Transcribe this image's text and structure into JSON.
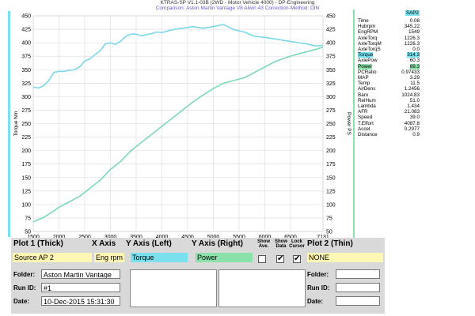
{
  "header": {
    "line1": "KTRAS-SP V1.1-03B  (2WD - Motor Vehicle 4000) - DP-Engineering",
    "line2": "Comparison: Aston Martin Vantage V8 Alwin 43    Correction-Method: DIN"
  },
  "chart_data": {
    "type": "line",
    "xlim": [
      1500,
      7131
    ],
    "x_ticks": [
      "1500",
      "2000",
      "2500",
      "3000",
      "3500",
      "4000",
      "4500",
      "5000",
      "5500",
      "6000",
      "6500",
      "7131"
    ],
    "ylim_left": [
      50,
      450
    ],
    "ylim_right": [
      50,
      450
    ],
    "y_ticks": [
      "50",
      "75",
      "100",
      "125",
      "150",
      "175",
      "200",
      "225",
      "250",
      "275",
      "300",
      "325",
      "350",
      "375",
      "400",
      "425",
      "450"
    ],
    "ylabel_left": "Torque Nm",
    "ylabel_right": "Power PS",
    "grid": true,
    "series": [
      {
        "name": "Torque",
        "axis": "left",
        "color": "#7bd8ea",
        "x": [
          1500,
          1600,
          1700,
          1800,
          1900,
          2000,
          2100,
          2200,
          2300,
          2400,
          2500,
          2600,
          2700,
          2800,
          2900,
          3000,
          3100,
          3200,
          3300,
          3400,
          3500,
          3600,
          3700,
          3800,
          3900,
          4000,
          4200,
          4400,
          4600,
          4800,
          5000,
          5200,
          5400,
          5600,
          5800,
          6000,
          6200,
          6400,
          6600,
          6800,
          7000,
          7131
        ],
        "y": [
          318,
          316,
          320,
          330,
          345,
          347,
          347,
          349,
          350,
          355,
          366,
          370,
          378,
          385,
          398,
          400,
          397,
          403,
          412,
          416,
          416,
          413,
          415,
          417,
          420,
          419,
          424,
          427,
          430,
          427,
          430,
          434,
          424,
          420,
          412,
          410,
          407,
          404,
          401,
          398,
          394,
          395
        ]
      },
      {
        "name": "Power",
        "axis": "right",
        "color": "#7dd8b5",
        "x": [
          1500,
          1600,
          1700,
          1800,
          1900,
          2000,
          2200,
          2400,
          2600,
          2800,
          3000,
          3200,
          3400,
          3600,
          3800,
          4000,
          4200,
          4400,
          4600,
          4800,
          5000,
          5200,
          5400,
          5600,
          5800,
          6000,
          6200,
          6400,
          6600,
          6800,
          7000,
          7131
        ],
        "y": [
          68,
          72,
          76,
          82,
          88,
          95,
          105,
          115,
          130,
          145,
          165,
          180,
          200,
          215,
          230,
          245,
          260,
          275,
          290,
          303,
          315,
          325,
          330,
          335,
          345,
          355,
          365,
          372,
          378,
          383,
          388,
          392
        ]
      }
    ]
  },
  "panel": {
    "title": "SAP2",
    "rows": [
      {
        "label": "Time",
        "value": "0.08"
      },
      {
        "label": "Hubrpm",
        "value": "345.22"
      },
      {
        "label": "EngRPM",
        "value": "1549"
      },
      {
        "label": "AxleTorq",
        "value": "1226.3"
      },
      {
        "label": "AxleTorqM",
        "value": "1226.3"
      },
      {
        "label": "AxleTorqS",
        "value": "0.0"
      },
      {
        "label": "Torque",
        "value": "314.3",
        "hl": "cyan"
      },
      {
        "label": "AxlePow",
        "value": "60.3"
      },
      {
        "label": "Power",
        "value": "69.3",
        "hl": "green"
      },
      {
        "label": "PCRatio",
        "value": "0.97433"
      },
      {
        "label": "MAP",
        "value": "3.29"
      },
      {
        "label": "Temp",
        "value": "11.5"
      },
      {
        "label": "AirDens",
        "value": "1.2456"
      },
      {
        "label": "Baro",
        "value": "1024.83"
      },
      {
        "label": "RelHum",
        "value": "51.0"
      },
      {
        "label": "Lambda",
        "value": "1.434"
      },
      {
        "label": "AFR",
        "value": "21.083"
      },
      {
        "label": "Speed",
        "value": "39.0"
      },
      {
        "label": "T.Effort",
        "value": "4087.8"
      },
      {
        "label": "Accel",
        "value": "0.2977"
      },
      {
        "label": "Distance",
        "value": "0.9"
      }
    ]
  },
  "controls": {
    "plot1_label": "Plot 1 (Thick)",
    "xaxis_label": "X Axis",
    "yleft_label": "Y Axis (Left)",
    "yright_label": "Y Axis (Right)",
    "show_ave_label": "Show Ave.",
    "show_data_label": "Show Data",
    "lock_cursor_label": "Lock Cursor",
    "plot2_label": "Plot 2 (Thin)",
    "plot1_value": "Source AP 2",
    "xaxis_value": "Eng rpm",
    "yleft_value": "Torque",
    "yright_value": "Power",
    "plot2_value": "NONE",
    "show_ave_checked": "",
    "show_data_checked": "✔",
    "lock_cursor_checked": "✔",
    "folder_label": "Folder:",
    "runid_label": "Run ID:",
    "date_label": "Date:",
    "folder_value": "Aston Martin Vantage",
    "runid_value": "#1",
    "date_value": "10-Dec-2015   15:31:30",
    "folder2_label": "Folder:",
    "runid2_label": "Run ID:",
    "date2_label": "Date:"
  }
}
